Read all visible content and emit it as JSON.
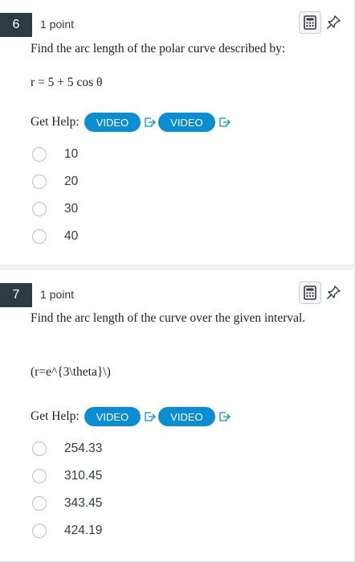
{
  "questions": [
    {
      "number": "6",
      "points": "1 point",
      "prompt": "Find the arc length of the polar curve described by:",
      "equation": "r = 5 + 5 cos θ",
      "get_help_label": "Get Help:",
      "video_buttons": [
        "VIDEO",
        "VIDEO"
      ],
      "options": [
        "10",
        "20",
        "30",
        "40"
      ]
    },
    {
      "number": "7",
      "points": "1 point",
      "prompt": "Find the arc length of the curve over the given interval.",
      "equation": "(r=e^{3\\theta}\\)",
      "get_help_label": "Get Help:",
      "video_buttons": [
        "VIDEO",
        "VIDEO"
      ],
      "options": [
        "254.33",
        "310.45",
        "343.45",
        "424.19"
      ]
    }
  ],
  "icons": {
    "calculator": "calculator-icon",
    "pin": "pin-icon",
    "external_link": "external-link-icon"
  },
  "colors": {
    "question_number_bg": "#2d3b45",
    "video_button": "#0a8ed1"
  }
}
